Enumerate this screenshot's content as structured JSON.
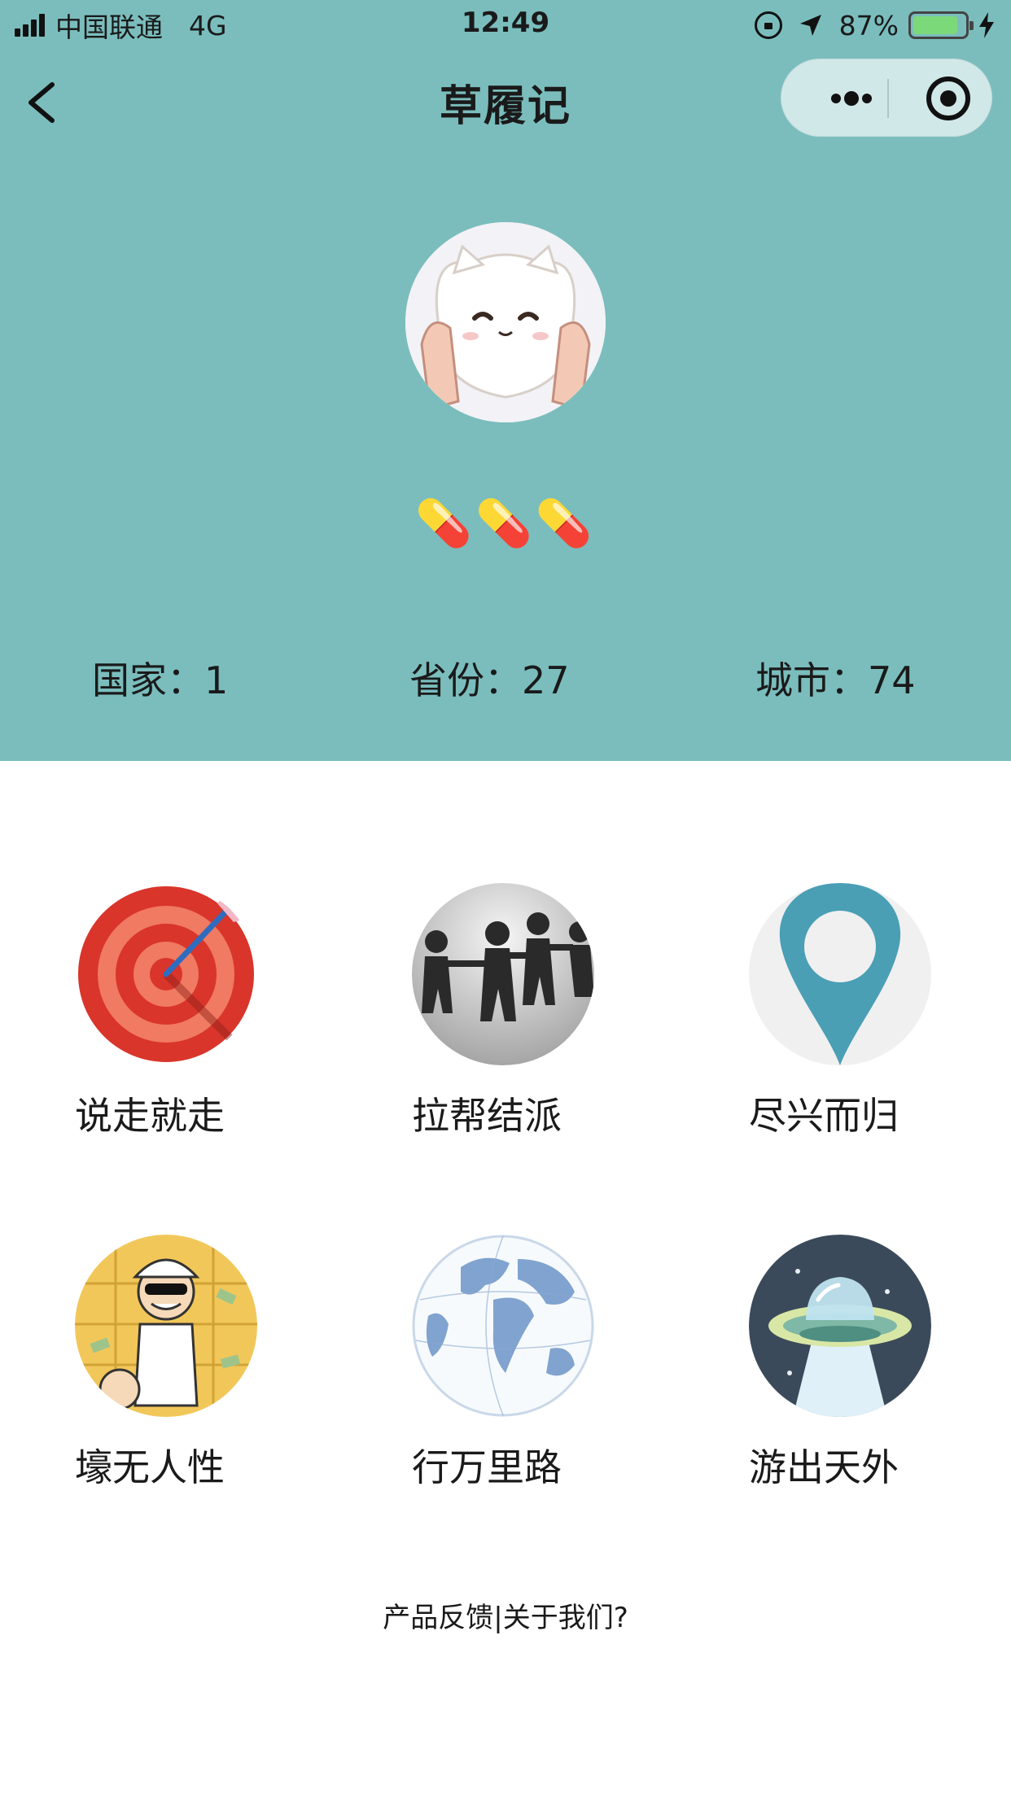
{
  "status_bar": {
    "carrier": "中国联通",
    "network": "4G",
    "time": "12:49",
    "battery": "87%",
    "battery_level": 0.87
  },
  "nav": {
    "title": "草履记"
  },
  "profile": {
    "badge": "💊💊💊"
  },
  "stats": [
    {
      "label": "国家：",
      "value": "1"
    },
    {
      "label": "省份：",
      "value": "27"
    },
    {
      "label": "城市：",
      "value": "74"
    }
  ],
  "grid": [
    {
      "label": "说走就走",
      "icon": "target-icon"
    },
    {
      "label": "拉帮结派",
      "icon": "paper-people-icon"
    },
    {
      "label": "尽兴而归",
      "icon": "map-pin-icon"
    },
    {
      "label": "壕无人性",
      "icon": "rich-man-icon"
    },
    {
      "label": "行万里路",
      "icon": "globe-icon"
    },
    {
      "label": "游出天外",
      "icon": "ufo-icon"
    }
  ],
  "footer": {
    "text": "产品反馈|关于我们?"
  },
  "colors": {
    "header_bg": "#7bbdbd",
    "battery_green": "#7cd97a",
    "pin_blue": "#4a9fb5"
  }
}
